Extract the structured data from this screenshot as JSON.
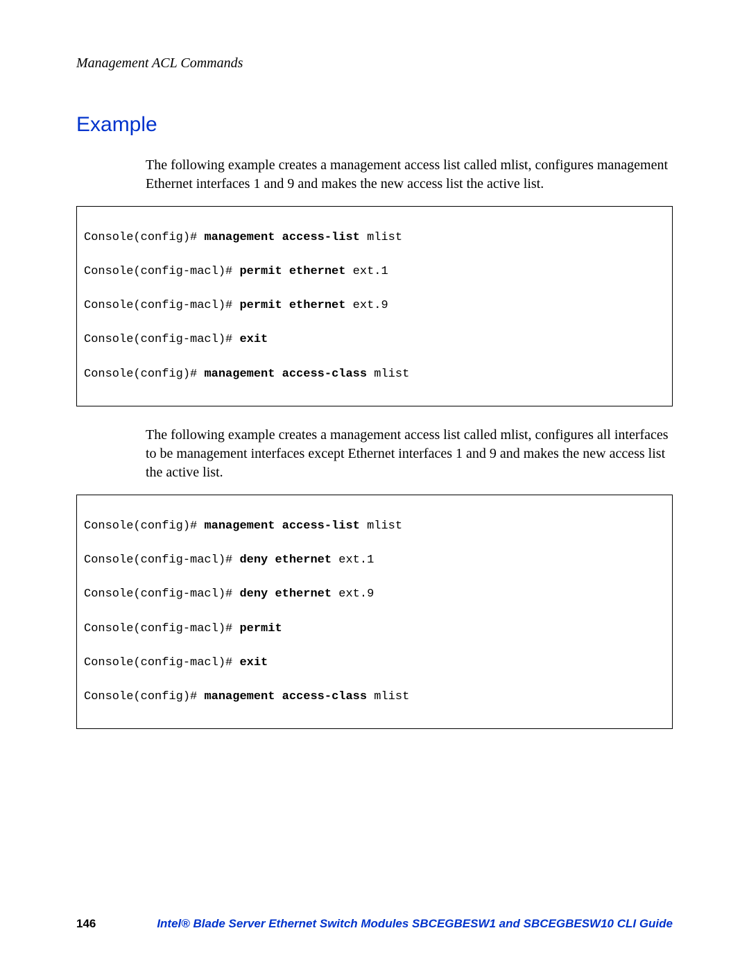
{
  "header": {
    "title": "Management ACL Commands"
  },
  "section": {
    "heading": "Example",
    "para1": "The following example creates a management access list called mlist, configures management Ethernet interfaces 1 and 9 and makes the new access list the active list.",
    "para2": "The following example creates a management access list called mlist, configures all interfaces to be management interfaces except Ethernet interfaces 1 and 9 and makes the new access list the active list."
  },
  "code1": {
    "l1_a": "Console(config)# ",
    "l1_b": "management access-list",
    "l1_c": " mlist",
    "l2_a": "Console(config-macl)# ",
    "l2_b": "permit ethernet",
    "l2_c": " ext.1",
    "l3_a": "Console(config-macl)# ",
    "l3_b": "permit ethernet",
    "l3_c": " ext.9",
    "l4_a": "Console(config-macl)# ",
    "l4_b": "exit",
    "l5_a": "Console(config)# ",
    "l5_b": "management access-class",
    "l5_c": " mlist"
  },
  "code2": {
    "l1_a": "Console(config)# ",
    "l1_b": "management access-list",
    "l1_c": " mlist",
    "l2_a": "Console(config-macl)# ",
    "l2_b": "deny ethernet",
    "l2_c": " ext.1",
    "l3_a": "Console(config-macl)# ",
    "l3_b": "deny ethernet",
    "l3_c": " ext.9",
    "l4_a": "Console(config-macl)# ",
    "l4_b": "permit",
    "l5_a": "Console(config-macl)# ",
    "l5_b": "exit",
    "l6_a": "Console(config)# ",
    "l6_b": "management access-class",
    "l6_c": " mlist"
  },
  "footer": {
    "page": "146",
    "title": "Intel® Blade Server Ethernet Switch Modules SBCEGBESW1 and SBCEGBESW10 CLI Guide"
  }
}
